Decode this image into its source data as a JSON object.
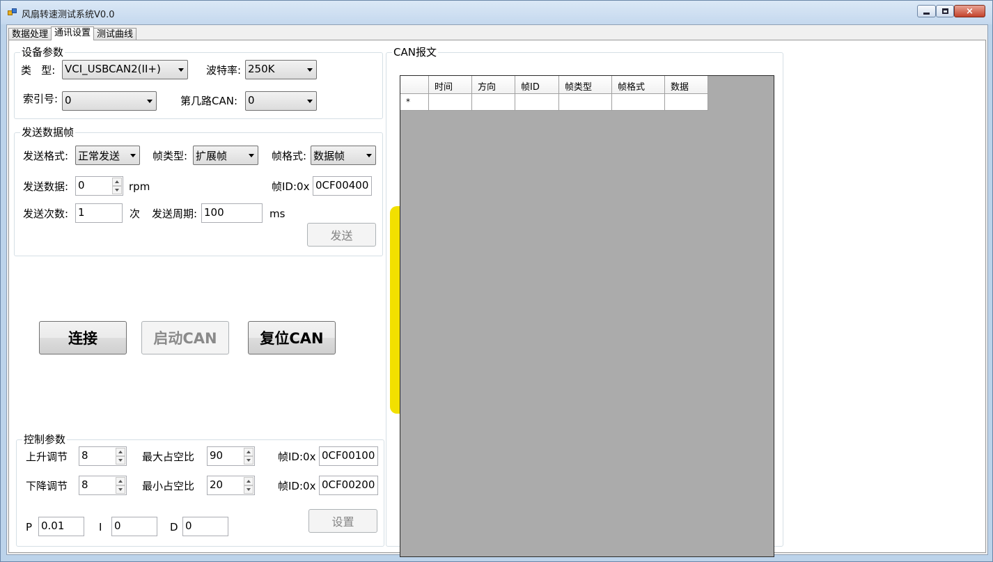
{
  "window": {
    "title": "风扇转速测试系统V0.0",
    "buttons": {
      "minimize": "minimize",
      "maximize": "maximize",
      "close": "×"
    }
  },
  "tabs": [
    {
      "label": "数据处理"
    },
    {
      "label": "通讯设置",
      "active": true
    },
    {
      "label": "测试曲线"
    }
  ],
  "device": {
    "title": "设备参数",
    "type_label": "类   型:",
    "type_value": "VCI_USBCAN2(II+)",
    "baud_label": "波特率:",
    "baud_value": "250K",
    "index_label": "索引号:",
    "index_value": "0",
    "can_channel_label": "第几路CAN:",
    "can_channel_value": "0"
  },
  "send": {
    "title": "发送数据帧",
    "format_label": "发送格式:",
    "format_value": "正常发送",
    "frame_type_label": "帧类型:",
    "frame_type_value": "扩展帧",
    "frame_format_label": "帧格式:",
    "frame_format_value": "数据帧",
    "data_label": "发送数据:",
    "data_value": "0",
    "data_unit": "rpm",
    "frame_id_label": "帧ID:0x",
    "frame_id_value": "0CF00400",
    "count_label": "发送次数:",
    "count_value": "1",
    "count_unit": "次",
    "period_label": "发送周期:",
    "period_value": "100",
    "period_unit": "ms",
    "send_button": "发送"
  },
  "actions": {
    "connect": "连接",
    "start_can": "启动CAN",
    "reset_can": "复位CAN"
  },
  "control": {
    "title": "控制参数",
    "rise_label": "上升调节",
    "rise_value": "8",
    "max_duty_label": "最大占空比",
    "max_duty_value": "90",
    "frame_id1_label": "帧ID:0x",
    "frame_id1_value": "0CF00100",
    "fall_label": "下降调节",
    "fall_value": "8",
    "min_duty_label": "最小占空比",
    "min_duty_value": "20",
    "frame_id2_label": "帧ID:0x",
    "frame_id2_value": "0CF00200",
    "p_label": "P",
    "p_value": "0.01",
    "i_label": "I",
    "i_value": "0",
    "d_label": "D",
    "d_value": "0",
    "set_button": "设置"
  },
  "can_log": {
    "title": "CAN报文",
    "columns": [
      "时间",
      "方向",
      "帧ID",
      "帧类型",
      "帧格式",
      "数据"
    ],
    "new_row_marker": "*"
  }
}
